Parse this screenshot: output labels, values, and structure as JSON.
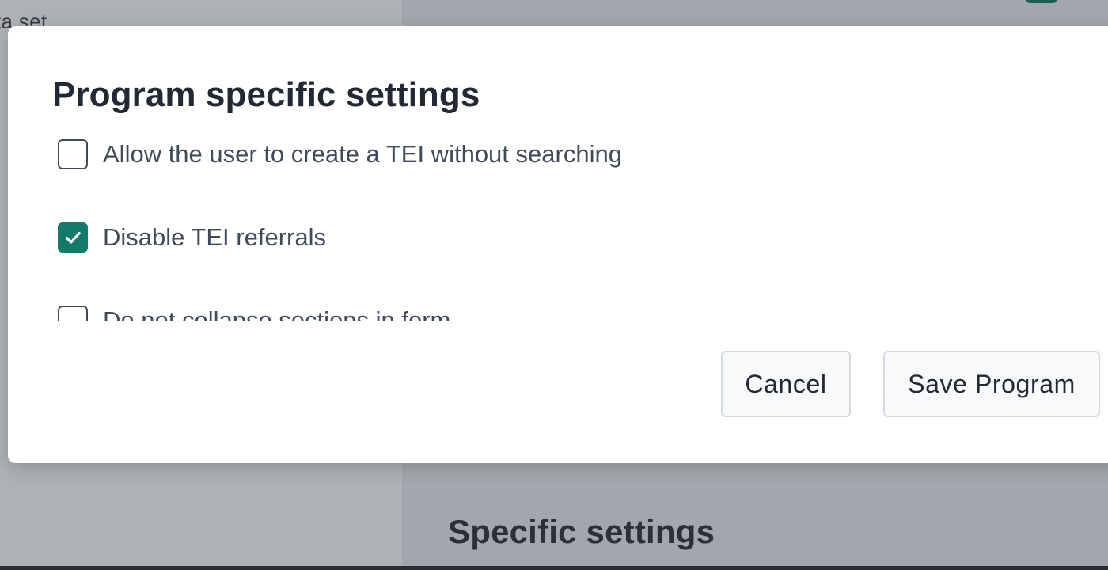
{
  "background": {
    "partial_label": "ta set",
    "section_heading": "Specific settings"
  },
  "dialog": {
    "title": "Program specific settings",
    "options": [
      {
        "label": "Allow the user to create a TEI without searching",
        "checked": false
      },
      {
        "label": "Disable TEI referrals",
        "checked": true
      },
      {
        "label": "Do not collapse sections in form",
        "checked": false
      }
    ],
    "buttons": {
      "cancel": "Cancel",
      "save": "Save Program"
    }
  },
  "colors": {
    "accent": "#147a6a",
    "text": "#404b5a",
    "title": "#212934"
  },
  "icons": {
    "checked_mark": "checkmark-icon"
  }
}
